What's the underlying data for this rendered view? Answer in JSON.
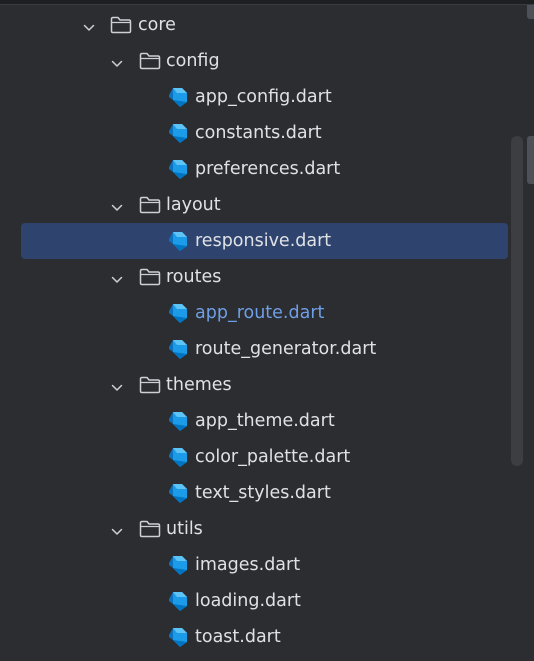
{
  "tree": {
    "rows": [
      {
        "kind": "folder",
        "level": 0,
        "label": "core"
      },
      {
        "kind": "folder",
        "level": 1,
        "label": "config"
      },
      {
        "kind": "file",
        "level": 2,
        "label": "app_config.dart"
      },
      {
        "kind": "file",
        "level": 2,
        "label": "constants.dart"
      },
      {
        "kind": "file",
        "level": 2,
        "label": "preferences.dart"
      },
      {
        "kind": "folder",
        "level": 1,
        "label": "layout"
      },
      {
        "kind": "file",
        "level": 2,
        "label": "responsive.dart",
        "selected": true
      },
      {
        "kind": "folder",
        "level": 1,
        "label": "routes"
      },
      {
        "kind": "file",
        "level": 2,
        "label": "app_route.dart",
        "highlighted": true
      },
      {
        "kind": "file",
        "level": 2,
        "label": "route_generator.dart"
      },
      {
        "kind": "folder",
        "level": 1,
        "label": "themes"
      },
      {
        "kind": "file",
        "level": 2,
        "label": "app_theme.dart"
      },
      {
        "kind": "file",
        "level": 2,
        "label": "color_palette.dart"
      },
      {
        "kind": "file",
        "level": 2,
        "label": "text_styles.dart"
      },
      {
        "kind": "folder",
        "level": 1,
        "label": "utils"
      },
      {
        "kind": "file",
        "level": 2,
        "label": "images.dart"
      },
      {
        "kind": "file",
        "level": 2,
        "label": "loading.dart"
      },
      {
        "kind": "file",
        "level": 2,
        "label": "toast.dart"
      }
    ]
  },
  "colors": {
    "background": "#2b2d30",
    "selection": "#2e436e",
    "text": "#dfe1e5",
    "link_text": "#6f9fe6",
    "dart_blue_light": "#5fc4f5",
    "dart_blue_dark": "#0175c2"
  },
  "icons": {
    "expanded_folder_chevron": "chevron-down-icon",
    "folder": "folder-icon",
    "dart_file": "dart-file-icon"
  }
}
